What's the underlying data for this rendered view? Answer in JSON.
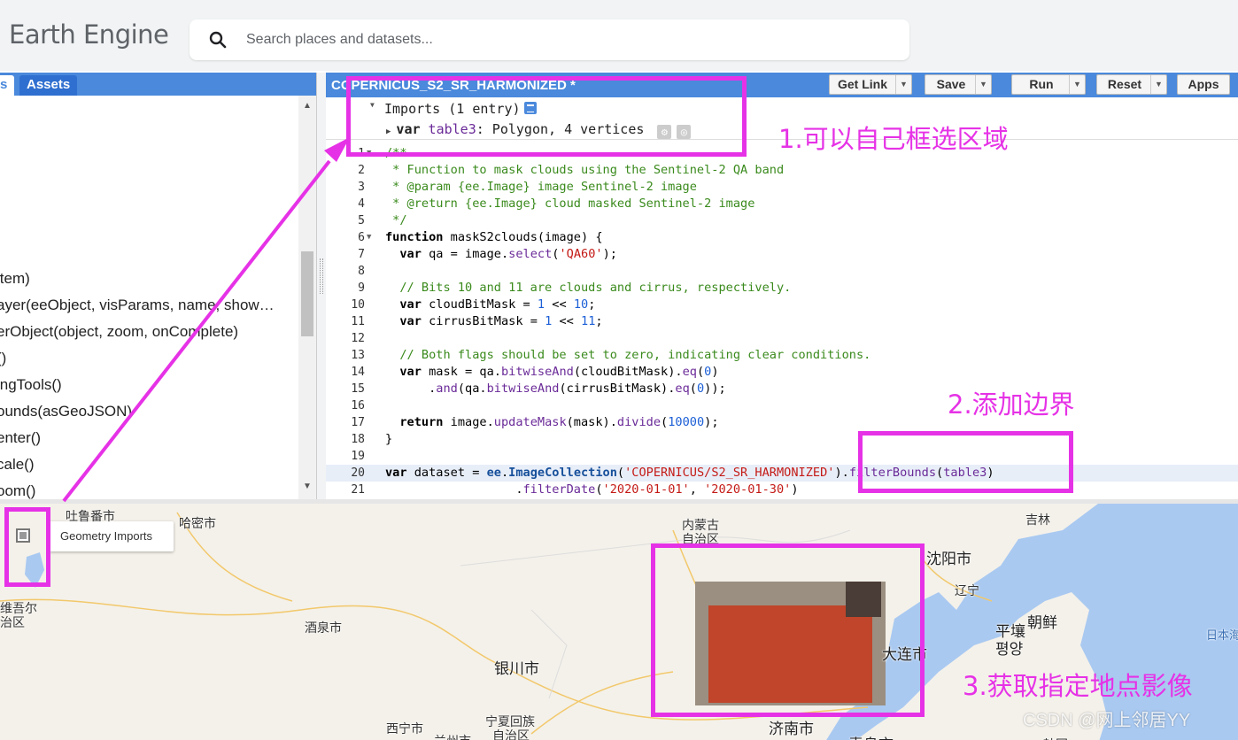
{
  "header": {
    "logo_text": "Earth Engine",
    "search_placeholder": "Search places and datasets..."
  },
  "left_panel": {
    "tabs": [
      {
        "label": "s"
      },
      {
        "label": "Assets"
      }
    ],
    "api_items": [
      "item)",
      "ayer(eeObject, visParams, name, show…",
      "erObject(object, zoom, onComplete)",
      "()",
      "ingTools()",
      "ounds(asGeoJSON)",
      "enter()",
      "cale()",
      "oom()"
    ]
  },
  "editor": {
    "title": "COPERNICUS_S2_SR_HARMONIZED *",
    "buttons": {
      "get_link": "Get Link",
      "save": "Save",
      "run": "Run",
      "reset": "Reset",
      "apps": "Apps"
    },
    "imports_label": "Imports (1 entry)",
    "import_var_kw": "var",
    "import_var_name": "table3",
    "import_var_desc": ": Polygon, 4 vertices",
    "code_lines": [
      {
        "n": "1",
        "t": "/**"
      },
      {
        "n": "2",
        "t": " * Function to mask clouds using the Sentinel-2 QA band"
      },
      {
        "n": "3",
        "t": " * @param {ee.Image} image Sentinel-2 image"
      },
      {
        "n": "4",
        "t": " * @return {ee.Image} cloud masked Sentinel-2 image"
      },
      {
        "n": "5",
        "t": " */"
      },
      {
        "n": "6",
        "t": "function maskS2clouds(image) {"
      },
      {
        "n": "7",
        "t": "  var qa = image.select('QA60');"
      },
      {
        "n": "8",
        "t": ""
      },
      {
        "n": "9",
        "t": "  // Bits 10 and 11 are clouds and cirrus, respectively."
      },
      {
        "n": "10",
        "t": "  var cloudBitMask = 1 << 10;"
      },
      {
        "n": "11",
        "t": "  var cirrusBitMask = 1 << 11;"
      },
      {
        "n": "12",
        "t": ""
      },
      {
        "n": "13",
        "t": "  // Both flags should be set to zero, indicating clear conditions."
      },
      {
        "n": "14",
        "t": "  var mask = qa.bitwiseAnd(cloudBitMask).eq(0)"
      },
      {
        "n": "15",
        "t": "      .and(qa.bitwiseAnd(cirrusBitMask).eq(0));"
      },
      {
        "n": "16",
        "t": ""
      },
      {
        "n": "17",
        "t": "  return image.updateMask(mask).divide(10000);"
      },
      {
        "n": "18",
        "t": "}"
      },
      {
        "n": "19",
        "t": ""
      },
      {
        "n": "20",
        "t": "var dataset = ee.ImageCollection('COPERNICUS/S2_SR_HARMONIZED').filterBounds(table3)"
      },
      {
        "n": "21",
        "t": "                  .filterDate('2020-01-01', '2020-01-30')"
      }
    ]
  },
  "map": {
    "geometry_imports_label": "Geometry Imports",
    "labels": {
      "tulufan": "吐鲁番市",
      "hami": "哈密市",
      "neimenggu1": "内蒙古",
      "neimenggu2": "自治区",
      "jilin": "吉林",
      "shenyang": "沈阳市",
      "liaoning": "辽宁",
      "pingrang_cn": "平壤",
      "pingrang_kr": "평양",
      "chaoxian": "朝鲜",
      "riben": "日本海",
      "xinjiang1": "维吾尔",
      "xinjiang2": "治区",
      "jiuquan": "酒泉市",
      "yinchuan": "银川市",
      "dalian": "大连市",
      "ningxia": "宁夏回族",
      "zizhiqu": "自治区",
      "xining": "西宁市",
      "lanzhou": "兰州市",
      "jinan": "济南市",
      "qingdao": "青岛市",
      "hanguo": "韩国"
    }
  },
  "annotations": {
    "step1": "1.可以自己框选区域",
    "step2": "2.添加边界",
    "step3": "3.获取指定地点影像",
    "watermark": "CSDN @网上邻居YY"
  },
  "colors": {
    "accent_blue": "#4a89dc",
    "annotation_magenta": "#e632e6",
    "water_blue": "#a9c9f1",
    "imagery_red": "#c0452a"
  }
}
